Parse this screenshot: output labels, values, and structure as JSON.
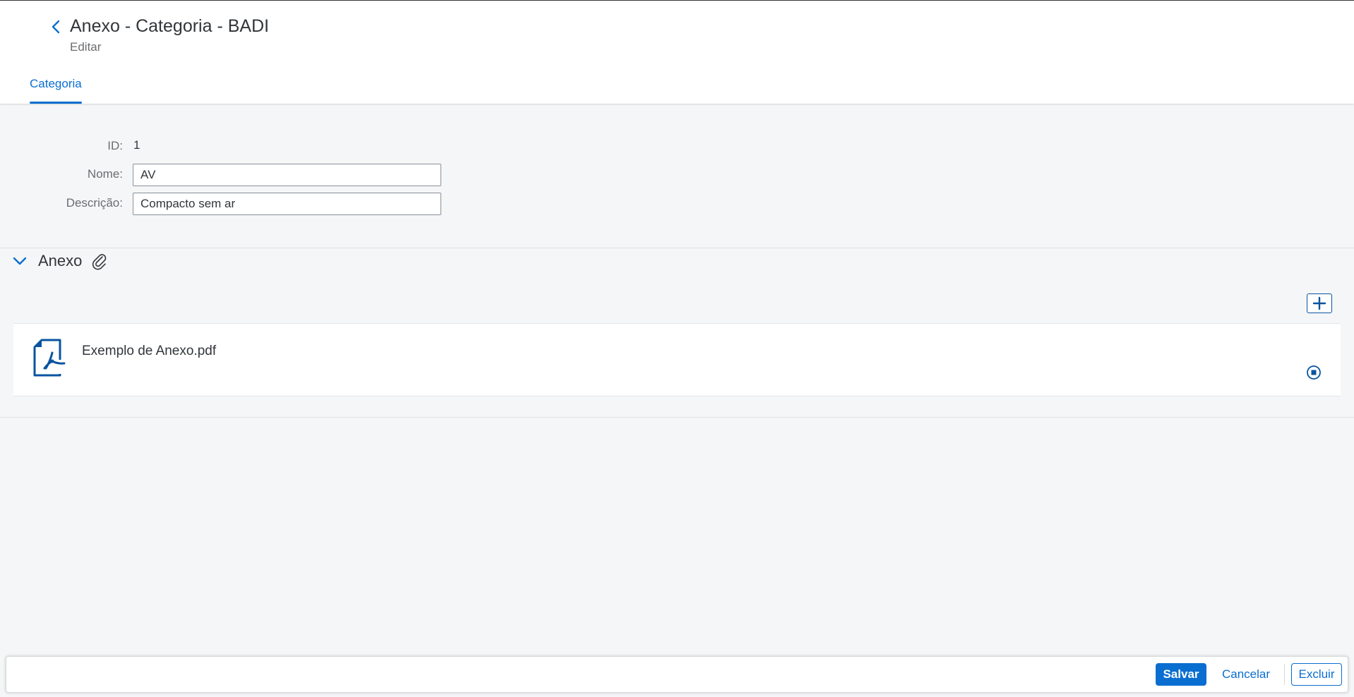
{
  "header": {
    "title": "Anexo - Categoria - BADI",
    "subtitle": "Editar",
    "tabs": [
      {
        "label": "Categoria",
        "active": true
      }
    ]
  },
  "form": {
    "id_label": "ID:",
    "id_value": "1",
    "nome_label": "Nome:",
    "nome_value": "AV",
    "descricao_label": "Descrição:",
    "descricao_value": "Compacto sem ar"
  },
  "attachments": {
    "section_title": "Anexo",
    "items": [
      {
        "file_name": "Exemplo de Anexo.pdf",
        "icon": "pdf-file-icon"
      }
    ]
  },
  "footer": {
    "save_label": "Salvar",
    "cancel_label": "Cancelar",
    "delete_label": "Excluir"
  },
  "colors": {
    "accent": "#0a6ed1",
    "accent_dark": "#0854a0",
    "background": "#f5f6f7",
    "text": "#32363a",
    "muted_text": "#6a6d70"
  }
}
